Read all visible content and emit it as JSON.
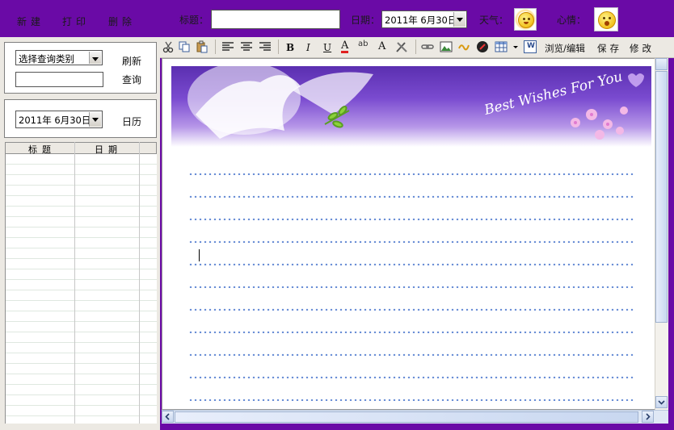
{
  "topbar": {
    "new_label": "新建",
    "print_label": "打印",
    "delete_label": "删除",
    "title_label": "标题：",
    "title_value": "",
    "date_label": "日期：",
    "date_value": "2011年 6月30日",
    "weather_label": "天气：",
    "mood_label": "心情："
  },
  "search": {
    "category_select": "选择查询类别",
    "refresh_label": "刷新",
    "query_value": "",
    "query_label": "查询"
  },
  "calendar": {
    "date_value": "2011年 6月30日",
    "calendar_label": "日历"
  },
  "grid": {
    "columns": [
      "标题",
      "日期"
    ],
    "rows": []
  },
  "toolbar": {
    "icons": [
      "cut-icon",
      "copy-icon",
      "paste-icon",
      "align-left-icon",
      "align-center-icon",
      "align-right-icon",
      "bold-icon",
      "italic-icon",
      "underline-icon",
      "font-color-icon",
      "highlight-icon",
      "font-size-icon",
      "tools-icon",
      "link-icon",
      "image-icon",
      "special-char-icon",
      "flash-icon",
      "table-icon",
      "word-icon"
    ],
    "bold": "B",
    "italic": "I",
    "underline": "U",
    "font_color": "A",
    "highlight": "ab",
    "font_size": "A",
    "word": "W",
    "browse_edit_label": "浏览/编辑",
    "save_label": "保存",
    "modify_label": "修改"
  },
  "editor": {
    "banner_text": "Best Wishes For You",
    "content": ""
  },
  "colors": {
    "frame": "#6a0aa6",
    "toolbar": "#ece9e3",
    "line": "#6b8fd6"
  }
}
